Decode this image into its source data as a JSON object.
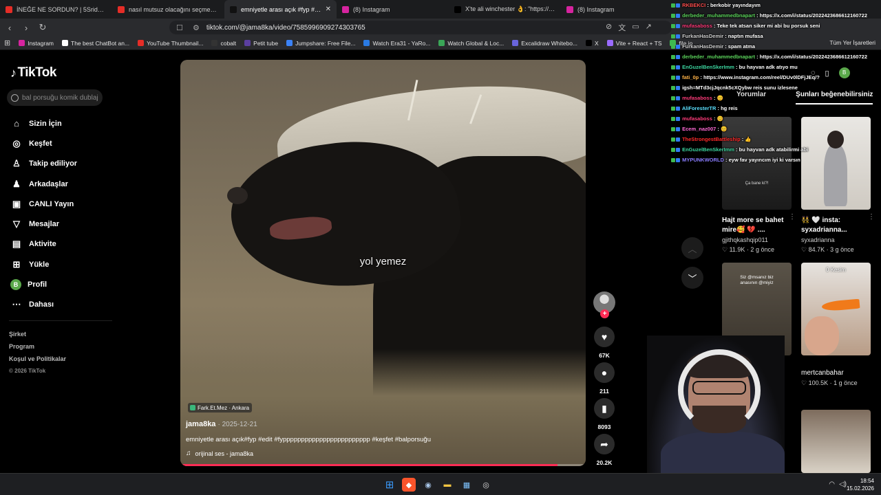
{
  "browser": {
    "tabs": [
      {
        "title": "İNEĞE NE SORDUN? | 5Sriders | Mob",
        "color": "#e52d27",
        "active": false
      },
      {
        "title": "nasıl mutsuz olacağını seçmen gerek",
        "color": "#e52d27",
        "active": false
      },
      {
        "title": "emniyetle arası açık #fyp #edit",
        "color": "#111111",
        "active": true
      },
      {
        "title": "(8) Instagram",
        "color": "#d6249f",
        "active": false
      },
      {
        "title": "X'te ali winchester 👌: \"https://t.co/f",
        "color": "#000000",
        "active": false
      },
      {
        "title": "(8) Instagram",
        "color": "#d6249f",
        "active": false
      }
    ],
    "url": "tiktok.com/@jama8ka/video/7585996909274303765",
    "bookmarks": [
      {
        "label": "Instagram",
        "color": "#d6249f"
      },
      {
        "label": "The best ChatBot an...",
        "color": "#ffffff"
      },
      {
        "label": "YouTube Thumbnail...",
        "color": "#e52d27"
      },
      {
        "label": "cobalt",
        "color": "#333333"
      },
      {
        "label": "Petit tube",
        "color": "#5b3fa0"
      },
      {
        "label": "Jumpshare: Free File...",
        "color": "#3b82f6"
      },
      {
        "label": "Watch Era31 - YaRo...",
        "color": "#2a7ae2"
      },
      {
        "label": "Watch Global & Loc...",
        "color": "#3aa657"
      },
      {
        "label": "Excalidraw Whitebo...",
        "color": "#6965db"
      },
      {
        "label": "X",
        "color": "#000000"
      },
      {
        "label": "Vite + React + TS",
        "color": "#9b6bff"
      },
      {
        "label": "file.io",
        "color": "#3fb950"
      }
    ],
    "bookmarks_all": "Tüm Yer İşaretleri"
  },
  "tiktok": {
    "brand": "TikTok",
    "search_placeholder": "bal porsuğu komik dublaj",
    "menu": [
      {
        "label": "Sizin İçin",
        "icon": "home-icon",
        "glyph": "⌂"
      },
      {
        "label": "Keşfet",
        "icon": "compass-icon",
        "glyph": "◎"
      },
      {
        "label": "Takip ediliyor",
        "icon": "following-icon",
        "glyph": "♙"
      },
      {
        "label": "Arkadaşlar",
        "icon": "friends-icon",
        "glyph": "♟"
      },
      {
        "label": "CANLI Yayın",
        "icon": "live-icon",
        "glyph": "▣"
      },
      {
        "label": "Mesajlar",
        "icon": "messages-icon",
        "glyph": "▽"
      },
      {
        "label": "Aktivite",
        "icon": "activity-icon",
        "glyph": "▤"
      },
      {
        "label": "Yükle",
        "icon": "upload-icon",
        "glyph": "⊞"
      },
      {
        "label": "Profil",
        "icon": "profile-icon",
        "glyph": "B"
      },
      {
        "label": "Dahası",
        "icon": "more-icon",
        "glyph": "⋯"
      }
    ],
    "footer": {
      "company": "Şirket",
      "program": "Program",
      "terms": "Koşul ve Politikalar",
      "copyright": "© 2026 TikTok"
    }
  },
  "video": {
    "subtitle": "yol yemez",
    "location": "Fark.Et.Mez · Ankara",
    "author": "jama8ka",
    "date": "· 2025-12-21",
    "caption": "emniyetle arası açık#fyp #edit #fypppppppppppppppppppppppp #keşfet #balporsuğu",
    "sound": "orijinal ses - jama8ka",
    "progress": 0.93,
    "likes": "67K",
    "comments": "211",
    "saves": "8093",
    "shares": "20.2K"
  },
  "right_panel": {
    "tab_comments": "Yorumlar",
    "tab_suggested": "Şunları beğenebilirsiniz",
    "profile_initial": "B",
    "cards": [
      {
        "title": "Hajt more se bahet mire🥰 💔 ....",
        "user": "gjithqkashqip011",
        "views": "♡ 11.9K",
        "ago": "· 2 g önce",
        "overlay": "Ça bane ki?!"
      },
      {
        "title": "👯 🤍 insta: syxadrianna...",
        "user": "syxadrianna",
        "views": "♡ 84.7K",
        "ago": "· 3 g önce",
        "overlay": ""
      },
      {
        "title": "",
        "user": "",
        "views": "",
        "ago": "",
        "overlay": "Siz @msanız biz anasının @miyiz"
      },
      {
        "title": "",
        "user": "mertcanbahar",
        "views": "♡ 100.5K",
        "ago": "· 1 g önce",
        "overlay": "0 Kesim"
      }
    ]
  },
  "chat": [
    {
      "user": "RKBEKCI",
      "msg": ": berkobir yayındayım",
      "color": "#ff4d4d"
    },
    {
      "user": "derbeder_muhammedbnapart",
      "msg": ": https://x.com/i/status/2022423686612160722",
      "color": "#5bd35b"
    },
    {
      "user": "mufasaboss",
      "msg": ": Teke tek atsan siker mi abi bu porsuk seni",
      "color": "#ff3b7a"
    },
    {
      "user": "FurkanHasDemir",
      "msg": ": naptın mufasa",
      "color": "#cfcfcf"
    },
    {
      "user": "FurkanHasDemir",
      "msg": ": spam atma",
      "color": "#cfcfcf"
    },
    {
      "user": "derbeder_muhammedbnapart",
      "msg": ": https://x.com/i/status/2022423686612160722",
      "color": "#5bd35b"
    },
    {
      "user": "EnGuzelBenSkerImm",
      "msg": ": bu hayvan adk atıyo mu",
      "color": "#3cd6a0"
    },
    {
      "user": "fati_0p",
      "msg": ": https://www.instagram.com/reel/DUv0lDFjJEq/?",
      "color": "#ffb347"
    },
    {
      "user": "igsh=MTd3cjJqcnk5cXQybw reis sunu izlesene",
      "msg": "",
      "color": "#ffffff"
    },
    {
      "user": "mufasaboss",
      "msg": ": 😊",
      "color": "#ff3b7a"
    },
    {
      "user": "AliForesterTR",
      "msg": ": hg reis",
      "color": "#5be0ff"
    },
    {
      "user": "mufasaboss",
      "msg": ": 😊",
      "color": "#ff3b7a"
    },
    {
      "user": "Ecem_naz007",
      "msg": ": 😊",
      "color": "#ff6ad5"
    },
    {
      "user": "TheStrongestBattleship",
      "msg": ": 👍",
      "color": "#ff2a2a"
    },
    {
      "user": "EnGuzelBenSkerImm",
      "msg": ": bu hayvan adk atabilirmi abi",
      "color": "#3cd6a0"
    },
    {
      "user": "MYPUNKWORLD",
      "msg": ": eyw fav yayıncım iyi ki varsın",
      "color": "#8a7dff"
    }
  ],
  "taskbar": {
    "time": "18:54",
    "date": "15.02.2026"
  }
}
